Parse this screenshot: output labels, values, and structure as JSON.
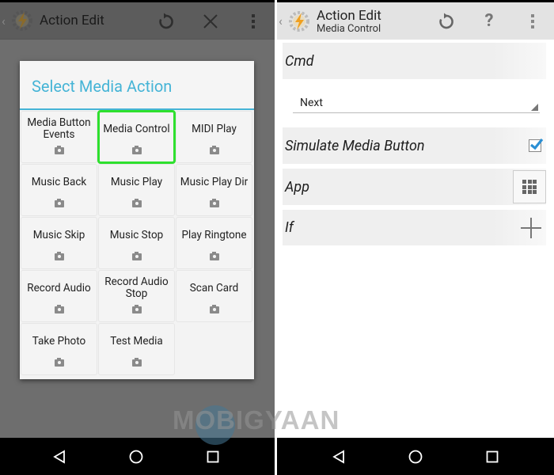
{
  "left_screen": {
    "actionbar": {
      "title": "Action Edit",
      "icons": [
        "back-chevron-icon",
        "tasker-logo-icon",
        "reset-icon",
        "close-icon",
        "overflow-menu-icon"
      ]
    },
    "dialog": {
      "title": "Select Media Action",
      "accent_color": "#45b4d6",
      "highlight_color": "#2ee02e",
      "items": [
        {
          "label": "Media Button Events",
          "icon": "camera-icon",
          "highlighted": false
        },
        {
          "label": "Media Control",
          "icon": "camera-icon",
          "highlighted": true
        },
        {
          "label": "MIDI Play",
          "icon": "camera-icon",
          "highlighted": false
        },
        {
          "label": "Music Back",
          "icon": "camera-icon",
          "highlighted": false
        },
        {
          "label": "Music Play",
          "icon": "camera-icon",
          "highlighted": false
        },
        {
          "label": "Music Play Dir",
          "icon": "camera-icon",
          "highlighted": false
        },
        {
          "label": "Music Skip",
          "icon": "camera-icon",
          "highlighted": false
        },
        {
          "label": "Music Stop",
          "icon": "camera-icon",
          "highlighted": false
        },
        {
          "label": "Play Ringtone",
          "icon": "camera-icon",
          "highlighted": false
        },
        {
          "label": "Record Audio",
          "icon": "camera-icon",
          "highlighted": false
        },
        {
          "label": "Record Audio Stop",
          "icon": "camera-icon",
          "highlighted": false
        },
        {
          "label": "Scan Card",
          "icon": "camera-icon",
          "highlighted": false
        },
        {
          "label": "Take Photo",
          "icon": "camera-icon",
          "highlighted": false
        },
        {
          "label": "Test Media",
          "icon": "camera-icon",
          "highlighted": false
        }
      ]
    }
  },
  "right_screen": {
    "actionbar": {
      "title": "Action Edit",
      "subtitle": "Media Control",
      "icons": [
        "back-chevron-icon",
        "tasker-logo-icon",
        "reset-icon",
        "help-icon",
        "overflow-menu-icon"
      ],
      "help_glyph": "?"
    },
    "fields": {
      "cmd_label": "Cmd",
      "cmd_value": "Next",
      "simulate_label": "Simulate Media Button",
      "simulate_checked": true,
      "app_label": "App",
      "if_label": "If"
    },
    "checkbox_color": "#2a8fd4"
  },
  "navbar": {
    "buttons": [
      "back-icon",
      "home-icon",
      "recents-icon"
    ]
  },
  "watermark": "MOBIGYAAN"
}
